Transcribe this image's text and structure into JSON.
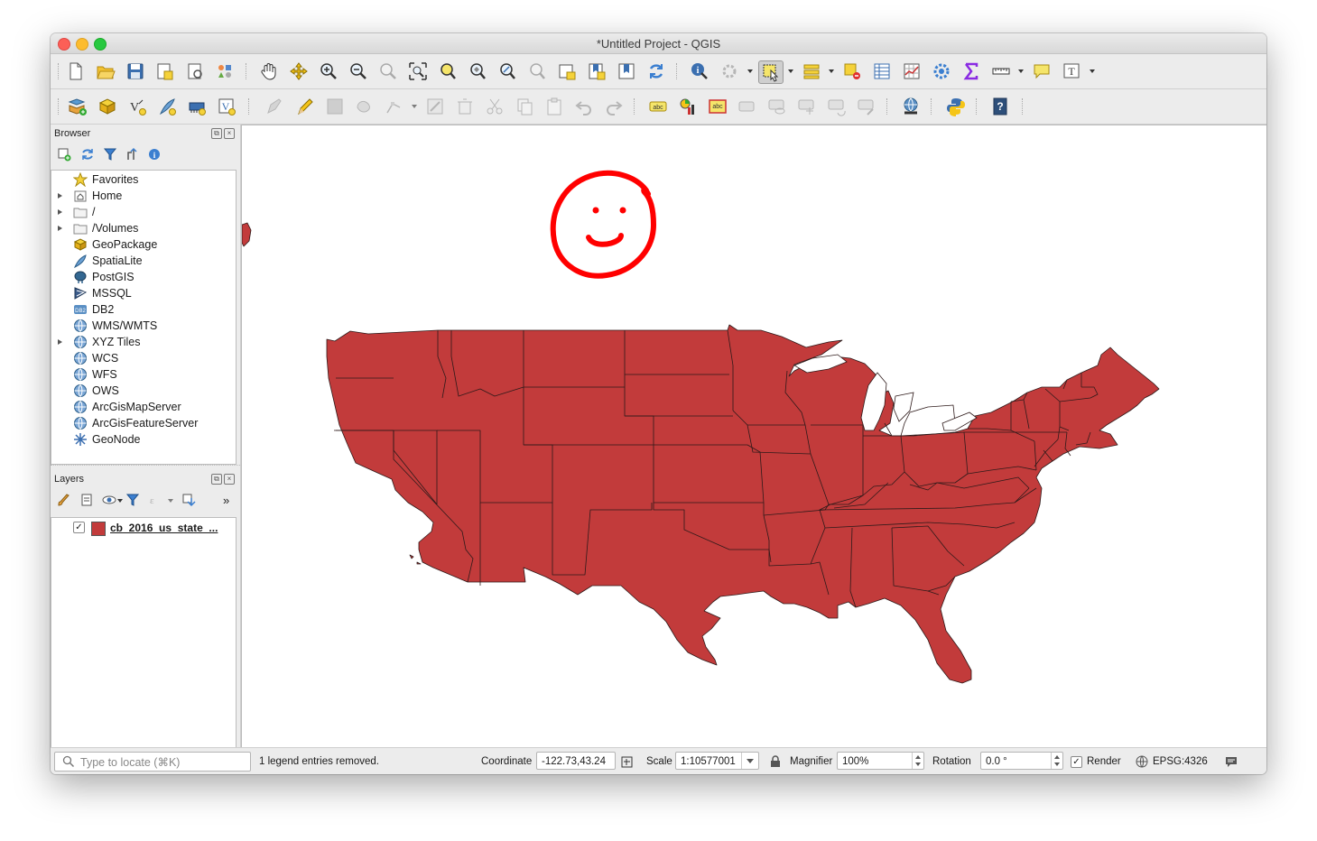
{
  "window": {
    "title": "*Untitled Project - QGIS"
  },
  "browser": {
    "title": "Browser",
    "items": [
      {
        "label": "Favorites",
        "expandable": false,
        "icon": "star-icon"
      },
      {
        "label": "Home",
        "expandable": true,
        "icon": "home-folder-icon"
      },
      {
        "label": "/",
        "expandable": true,
        "icon": "folder-icon"
      },
      {
        "label": "/Volumes",
        "expandable": true,
        "icon": "folder-icon"
      },
      {
        "label": "GeoPackage",
        "expandable": false,
        "icon": "geopackage-icon"
      },
      {
        "label": "SpatiaLite",
        "expandable": false,
        "icon": "spatialite-icon"
      },
      {
        "label": "PostGIS",
        "expandable": false,
        "icon": "postgis-icon"
      },
      {
        "label": "MSSQL",
        "expandable": false,
        "icon": "mssql-icon"
      },
      {
        "label": "DB2",
        "expandable": false,
        "icon": "db2-icon"
      },
      {
        "label": "WMS/WMTS",
        "expandable": false,
        "icon": "globe-icon"
      },
      {
        "label": "XYZ Tiles",
        "expandable": true,
        "icon": "globe-icon"
      },
      {
        "label": "WCS",
        "expandable": false,
        "icon": "globe-icon"
      },
      {
        "label": "WFS",
        "expandable": false,
        "icon": "globe-icon"
      },
      {
        "label": "OWS",
        "expandable": false,
        "icon": "globe-icon"
      },
      {
        "label": "ArcGisMapServer",
        "expandable": false,
        "icon": "globe-icon"
      },
      {
        "label": "ArcGisFeatureServer",
        "expandable": false,
        "icon": "globe-icon"
      },
      {
        "label": "GeoNode",
        "expandable": false,
        "icon": "geonode-icon"
      }
    ]
  },
  "layers": {
    "title": "Layers",
    "items": [
      {
        "label": "cb_2016_us_state_...",
        "checked": true,
        "color": "#c23b3b"
      }
    ]
  },
  "map": {
    "fill_color": "#c23b3b",
    "annotation_color": "#ff0000"
  },
  "status": {
    "locate_placeholder": "Type to locate (⌘K)",
    "message": "1 legend entries removed.",
    "coordinate_label": "Coordinate",
    "coordinate_value": "-122.73,43.24",
    "scale_label": "Scale",
    "scale_value": "1:10577001",
    "magnifier_label": "Magnifier",
    "magnifier_value": "100%",
    "rotation_label": "Rotation",
    "rotation_value": "0.0 °",
    "render_label": "Render",
    "render_checked": true,
    "crs": "EPSG:4326"
  }
}
